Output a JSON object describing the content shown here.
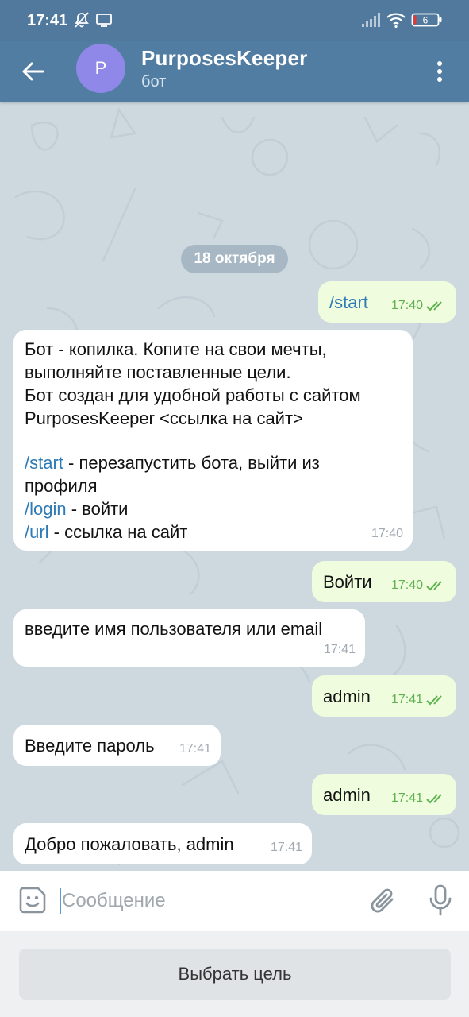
{
  "status_bar": {
    "time": "17:41",
    "battery": "6"
  },
  "header": {
    "avatar_letter": "P",
    "title": "PurposesKeeper",
    "subtitle": "бот"
  },
  "chat": {
    "date": "18 октября",
    "messages": [
      {
        "dir": "out",
        "text": "/start",
        "time": "17:40"
      },
      {
        "dir": "in",
        "line1": "Бот - копилка. Копите на свои мечты,",
        "line2": "выполняйте поставленные цели.",
        "line3": "Бот создан для удобной работы с сайтом",
        "line4": "PurposesKeeper <ссылка на сайт>",
        "cmd_start": "/start",
        "cmd_start_desc": " - перезапустить бота, выйти из",
        "cmd_start_desc2": "профиля",
        "cmd_login": "/login",
        "cmd_login_desc": " - войти",
        "cmd_url": "/url",
        "cmd_url_desc": " - ссылка на сайт",
        "time": "17:40"
      },
      {
        "dir": "out",
        "text": "Войти",
        "time": "17:40"
      },
      {
        "dir": "in",
        "text": "введите имя пользователя или email",
        "time": "17:41"
      },
      {
        "dir": "out",
        "text": "admin",
        "time": "17:41"
      },
      {
        "dir": "in",
        "text": "Введите пароль",
        "time": "17:41"
      },
      {
        "dir": "out",
        "text": "admin",
        "time": "17:41"
      },
      {
        "dir": "in",
        "text": "Добро пожаловать, admin",
        "time": "17:41"
      }
    ]
  },
  "composer": {
    "placeholder": "Сообщение"
  },
  "reply_keyboard": {
    "button_label": "Выбрать цель"
  },
  "colors": {
    "header": "#517da2",
    "outgoing_bubble": "#effdde",
    "incoming_bubble": "#ffffff",
    "link": "#2f7bb5",
    "read_checks": "#5fb150"
  },
  "icons": [
    "back-arrow-icon",
    "more-vert-icon",
    "sticker-icon",
    "paperclip-icon",
    "microphone-icon",
    "double-check-icon",
    "signal-icon",
    "wifi-icon",
    "battery-icon",
    "mute-bell-icon",
    "cast-icon"
  ]
}
